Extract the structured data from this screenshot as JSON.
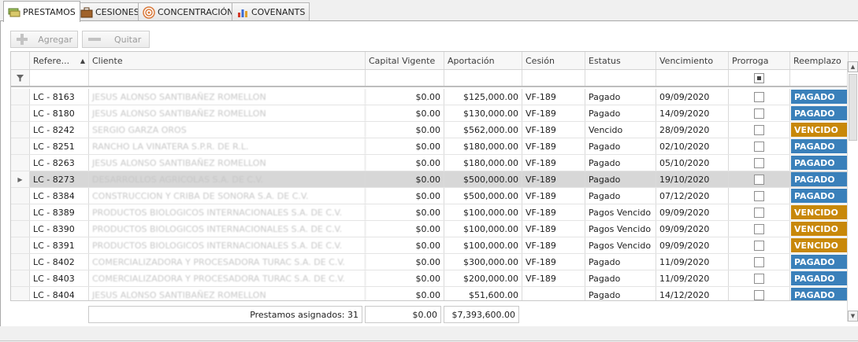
{
  "tabs": [
    {
      "label": "PRESTAMOS",
      "icon": "loans-icon",
      "active": true
    },
    {
      "label": "CESIONES",
      "icon": "briefcase-icon",
      "active": false
    },
    {
      "label": "CONCENTRACIÓN",
      "icon": "target-icon",
      "active": false
    },
    {
      "label": "COVENANTS",
      "icon": "bar-chart-icon",
      "active": false
    }
  ],
  "toolbar": {
    "add_label": "Agregar",
    "remove_label": "Quitar"
  },
  "grid": {
    "columns": {
      "referencia": "Refere...",
      "cliente": "Cliente",
      "capital": "Capital Vigente",
      "aportacion": "Aportación",
      "cesion": "Cesión",
      "estatus": "Estatus",
      "vencimiento": "Vencimiento",
      "prorroga": "Prorroga",
      "reemplazo": "Reemplazo"
    },
    "rows": [
      {
        "ref": "LC - 8163",
        "cliente": "JESUS ALONSO SANTIBAÑEZ ROMELLON",
        "capital": "$0.00",
        "aportacion": "$125,000.00",
        "cesion": "VF-189",
        "estatus": "Pagado",
        "vencimiento": "09/09/2020",
        "reemplazo": "PAGADO"
      },
      {
        "ref": "LC - 8180",
        "cliente": "JESUS ALONSO SANTIBAÑEZ ROMELLON",
        "capital": "$0.00",
        "aportacion": "$130,000.00",
        "cesion": "VF-189",
        "estatus": "Pagado",
        "vencimiento": "14/09/2020",
        "reemplazo": "PAGADO"
      },
      {
        "ref": "LC - 8242",
        "cliente": "SERGIO GARZA OROS",
        "capital": "$0.00",
        "aportacion": "$562,000.00",
        "cesion": "VF-189",
        "estatus": "Vencido",
        "vencimiento": "28/09/2020",
        "reemplazo": "VENCIDO"
      },
      {
        "ref": "LC - 8251",
        "cliente": "RANCHO LA VINATERA S.P.R. DE R.L.",
        "capital": "$0.00",
        "aportacion": "$180,000.00",
        "cesion": "VF-189",
        "estatus": "Pagado",
        "vencimiento": "02/10/2020",
        "reemplazo": "PAGADO"
      },
      {
        "ref": "LC - 8263",
        "cliente": "JESUS ALONSO SANTIBAÑEZ ROMELLON",
        "capital": "$0.00",
        "aportacion": "$180,000.00",
        "cesion": "VF-189",
        "estatus": "Pagado",
        "vencimiento": "05/10/2020",
        "reemplazo": "PAGADO"
      },
      {
        "ref": "LC - 8273",
        "cliente": "DESARROLLOS AGRICOLAS S.A. DE C.V.",
        "capital": "$0.00",
        "aportacion": "$500,000.00",
        "cesion": "VF-189",
        "estatus": "Pagado",
        "vencimiento": "19/10/2020",
        "reemplazo": "PAGADO",
        "selected": true
      },
      {
        "ref": "LC - 8384",
        "cliente": "CONSTRUCCION Y CRIBA DE SONORA S.A. DE C.V.",
        "capital": "$0.00",
        "aportacion": "$500,000.00",
        "cesion": "VF-189",
        "estatus": "Pagado",
        "vencimiento": "07/12/2020",
        "reemplazo": "PAGADO"
      },
      {
        "ref": "LC - 8389",
        "cliente": "PRODUCTOS BIOLOGICOS INTERNACIONALES S.A. DE C.V.",
        "capital": "$0.00",
        "aportacion": "$100,000.00",
        "cesion": "VF-189",
        "estatus": "Pagos Vencido",
        "vencimiento": "09/09/2020",
        "reemplazo": "VENCIDO"
      },
      {
        "ref": "LC - 8390",
        "cliente": "PRODUCTOS BIOLOGICOS INTERNACIONALES S.A. DE C.V.",
        "capital": "$0.00",
        "aportacion": "$100,000.00",
        "cesion": "VF-189",
        "estatus": "Pagos Vencido",
        "vencimiento": "09/09/2020",
        "reemplazo": "VENCIDO"
      },
      {
        "ref": "LC - 8391",
        "cliente": "PRODUCTOS BIOLOGICOS INTERNACIONALES S.A. DE C.V.",
        "capital": "$0.00",
        "aportacion": "$100,000.00",
        "cesion": "VF-189",
        "estatus": "Pagos Vencido",
        "vencimiento": "09/09/2020",
        "reemplazo": "VENCIDO"
      },
      {
        "ref": "LC - 8402",
        "cliente": "COMERCIALIZADORA Y PROCESADORA TURAC S.A. DE C.V.",
        "capital": "$0.00",
        "aportacion": "$300,000.00",
        "cesion": "VF-189",
        "estatus": "Pagado",
        "vencimiento": "11/09/2020",
        "reemplazo": "PAGADO"
      },
      {
        "ref": "LC - 8403",
        "cliente": "COMERCIALIZADORA Y PROCESADORA TURAC S.A. DE C.V.",
        "capital": "$0.00",
        "aportacion": "$200,000.00",
        "cesion": "VF-189",
        "estatus": "Pagado",
        "vencimiento": "11/09/2020",
        "reemplazo": "PAGADO"
      },
      {
        "ref": "LC - 8404",
        "cliente": "JESUS ALONSO SANTIBAÑEZ ROMELLON",
        "capital": "$0.00",
        "aportacion": "$51,600.00",
        "cesion": "",
        "estatus": "Pagado",
        "vencimiento": "14/12/2020",
        "reemplazo": "PAGADO"
      }
    ]
  },
  "summary": {
    "assigned": "Prestamos asignados: 31",
    "capital_total": "$0.00",
    "aportacion_total": "$7,393,600.00"
  },
  "colors": {
    "pagado": "#3a80ba",
    "vencido": "#c8880a",
    "selected_row": "#d7d7d7"
  }
}
